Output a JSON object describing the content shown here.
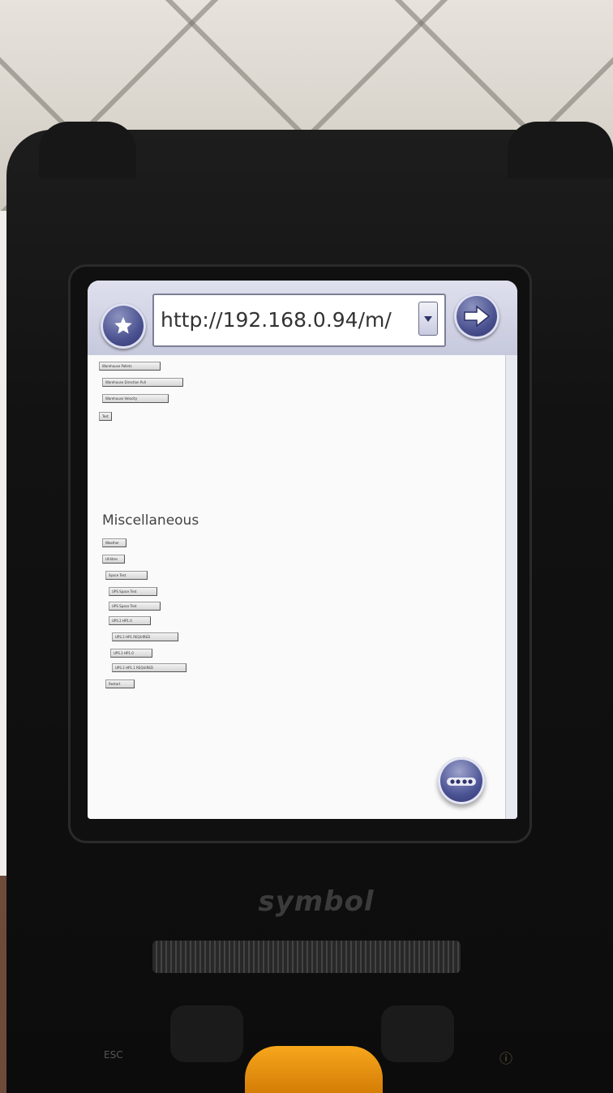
{
  "device": {
    "brand": "symbol",
    "esc_label": "ESC",
    "power_symbol": "ⓘ"
  },
  "browser": {
    "url": "http://192.168.0.94/m/",
    "favorites_icon": "star-icon",
    "go_icon": "arrow-right-icon",
    "dropdown_icon": "chevron-down-icon",
    "more_icon": "more-dots-icon"
  },
  "page": {
    "buttons_top": [
      "Warehouse Pallets",
      "Warehouse Direction Pull",
      "Warehouse Velocity",
      "Test"
    ],
    "section_title": "Miscellaneous",
    "buttons_misc": [
      "Weather",
      "Utilities",
      "Space Test",
      "UPS Space Test",
      "UPS Space Test",
      "UPS 2 HP1.0",
      "UPS 2 HP1 REQUIRED",
      "UPS 2 HP1.0",
      "UPS 2 HP1.1 REQUIRED",
      "Restart"
    ]
  },
  "colors": {
    "accent": "#4b5290",
    "trigger": "#f7a71c"
  }
}
